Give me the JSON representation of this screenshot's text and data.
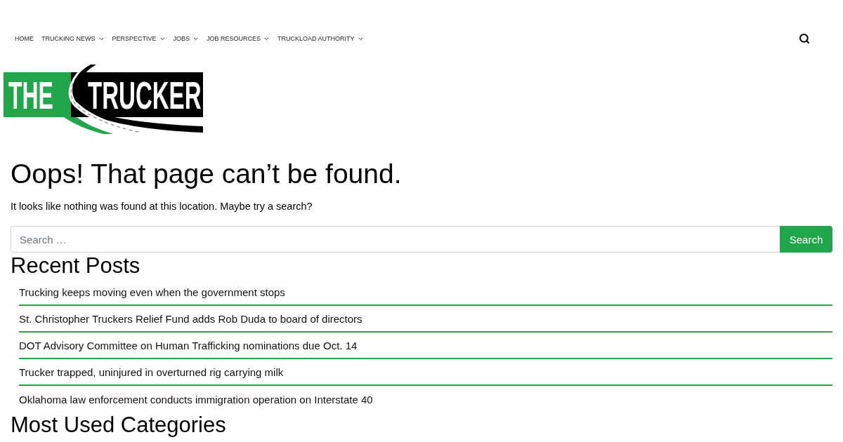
{
  "nav": {
    "items": [
      {
        "label": "HOME",
        "dropdown": false
      },
      {
        "label": "TRUCKING NEWS",
        "dropdown": true
      },
      {
        "label": "PERSPECTIVE",
        "dropdown": true
      },
      {
        "label": "JOBS",
        "dropdown": true
      },
      {
        "label": "JOB RESOURCES",
        "dropdown": true
      },
      {
        "label": "TRUCKLOAD AUTHORITY",
        "dropdown": true
      }
    ]
  },
  "logo": {
    "left_text": "THE",
    "right_text": "TRUCKER"
  },
  "page": {
    "title": "Oops! That page can’t be found.",
    "message": "It looks like nothing was found at this location. Maybe try a search?"
  },
  "search_form": {
    "placeholder": "Search …",
    "button": "Search"
  },
  "recent_posts": {
    "heading": "Recent Posts",
    "items": [
      "Trucking keeps moving even when the government stops",
      "St. Christopher Truckers Relief Fund adds Rob Duda to board of directors",
      "DOT Advisory Committee on Human Trafficking nominations due Oct. 14",
      "Trucker trapped, uninjured in overturned rig carrying milk",
      "Oklahoma law enforcement conducts immigration operation on Interstate 40"
    ]
  },
  "categories": {
    "heading": "Most Used Categories"
  }
}
